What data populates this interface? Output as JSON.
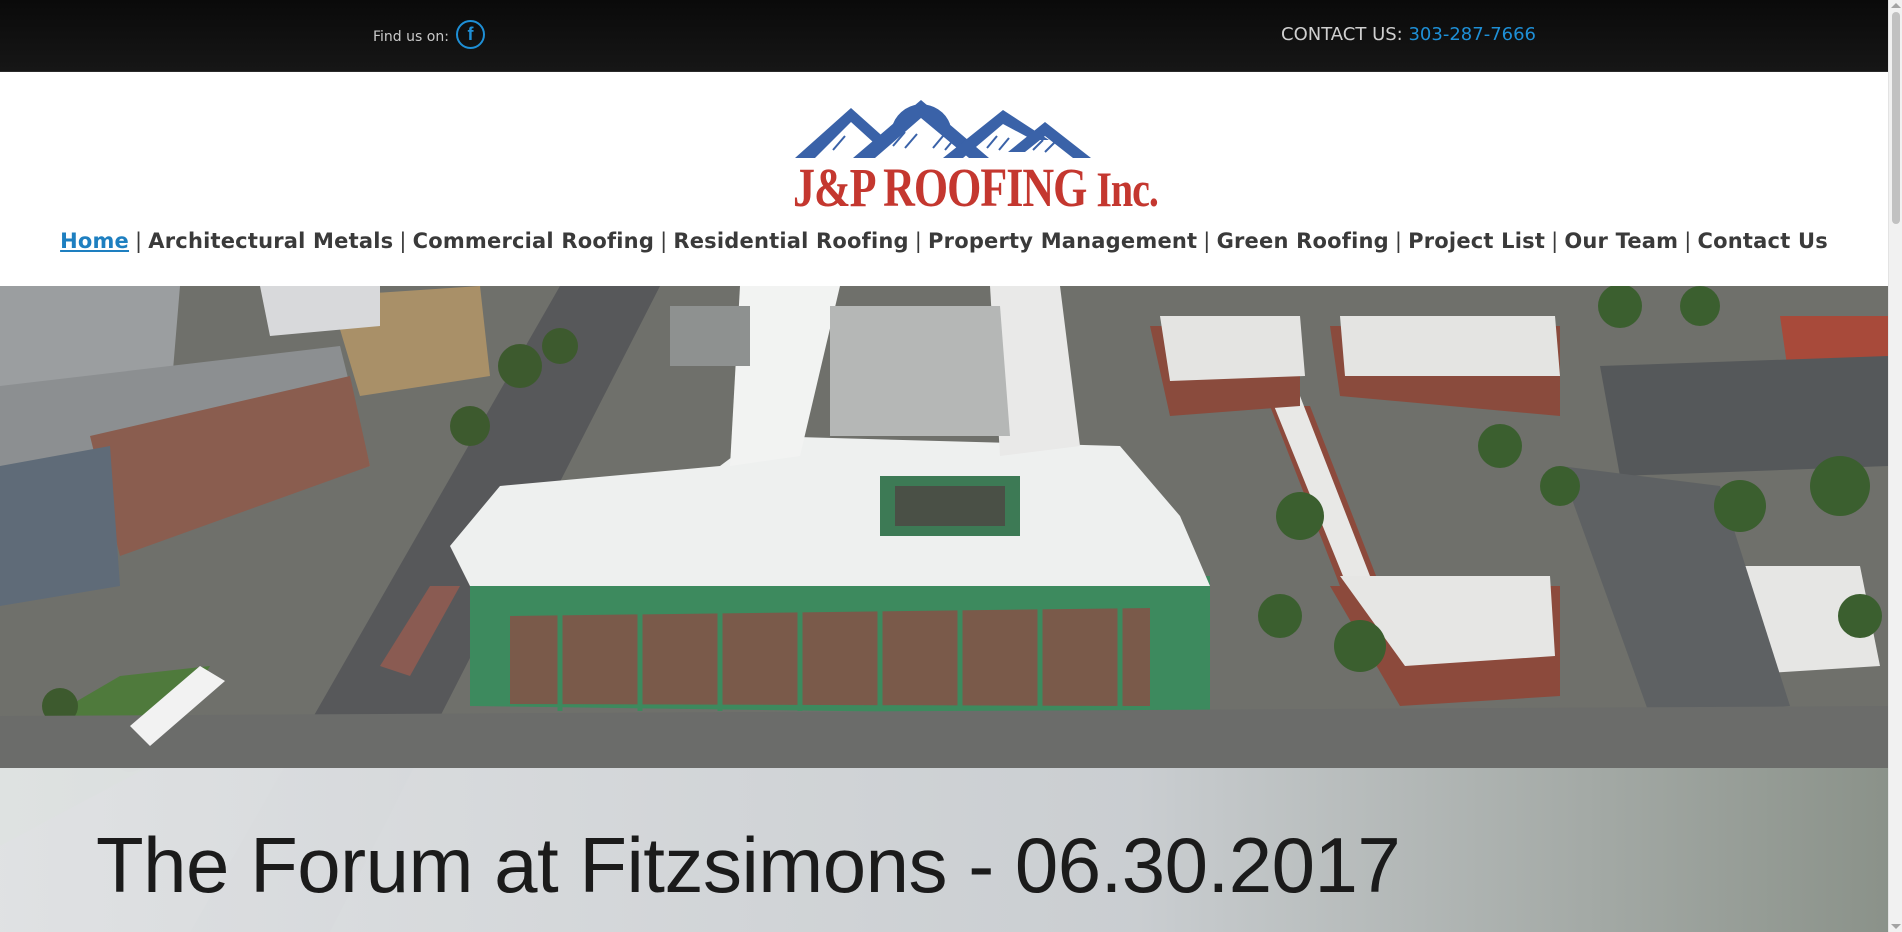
{
  "topbar": {
    "find_us_label": "Find us on:",
    "facebook_icon_glyph": "f",
    "contact_label": "CONTACT US:",
    "contact_phone": "303-287-7666"
  },
  "logo": {
    "company_name": "J&P ROOFING",
    "suffix": "Inc.",
    "brand_red": "#c4372f",
    "brand_blue": "#3a62a8"
  },
  "nav": {
    "items": [
      {
        "label": "Home",
        "active": true
      },
      {
        "label": "Architectural Metals"
      },
      {
        "label": "Commercial Roofing"
      },
      {
        "label": "Residential Roofing"
      },
      {
        "label": "Property Management"
      },
      {
        "label": "Green Roofing"
      },
      {
        "label": "Project List"
      },
      {
        "label": "Our Team"
      },
      {
        "label": "Contact Us"
      }
    ],
    "separator": "|",
    "active_color": "#1e7fc0"
  },
  "hero": {
    "caption": "The Forum at Fitzsimons - 06.30.2017"
  }
}
